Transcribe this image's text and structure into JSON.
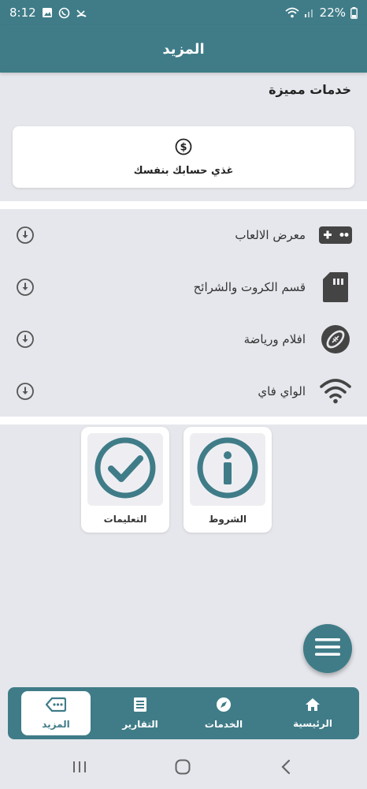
{
  "status_bar": {
    "time": "8:12",
    "battery": "22%"
  },
  "header": {
    "title": "المزيد"
  },
  "premium": {
    "section_title": "خدمات مميزة",
    "card_label": "غذي حسابك بنفسك",
    "card_icon": "dollar-circle-icon"
  },
  "menu": {
    "items": [
      {
        "label": "معرض الالعاب",
        "icon": "gamepad-icon"
      },
      {
        "label": "قسم الكروت والشرائح",
        "icon": "sim-card-icon"
      },
      {
        "label": "افلام ورياضة",
        "icon": "football-icon"
      },
      {
        "label": "الواي فاي",
        "icon": "wifi-icon"
      }
    ]
  },
  "tiles": {
    "terms": {
      "label": "الشروط",
      "icon": "info-icon"
    },
    "instructions": {
      "label": "التعليمات",
      "icon": "check-circle-icon"
    }
  },
  "bottom_nav": {
    "items": [
      {
        "label": "الرئيسية",
        "icon": "home-icon",
        "active": false
      },
      {
        "label": "الخدمات",
        "icon": "compass-icon",
        "active": false
      },
      {
        "label": "التقارير",
        "icon": "report-icon",
        "active": false
      },
      {
        "label": "المزيد",
        "icon": "more-tag-icon",
        "active": true
      }
    ]
  },
  "colors": {
    "primary": "#3f7c88",
    "background": "#e6e7ec",
    "card": "#ffffff"
  }
}
